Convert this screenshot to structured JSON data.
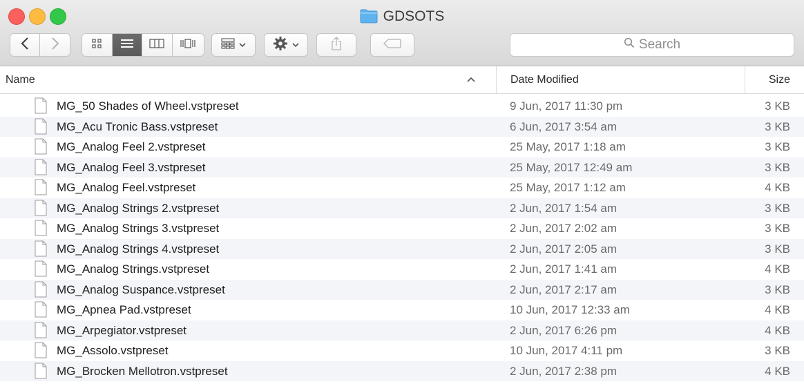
{
  "window": {
    "title": "GDSOTS"
  },
  "toolbar": {
    "back": "back",
    "forward": "forward",
    "view_modes": [
      "icon-view",
      "list-view",
      "column-view",
      "cover-flow-view"
    ],
    "active_view": "list-view",
    "arrange": "arrange",
    "action": "action",
    "share": "share",
    "tags": "tags"
  },
  "search": {
    "placeholder": "Search"
  },
  "columns": {
    "name": "Name",
    "date": "Date Modified",
    "size": "Size"
  },
  "files": [
    {
      "name": "MG_50 Shades of Wheel.vstpreset",
      "date": "9 Jun, 2017 11:30 pm",
      "size": "3 KB"
    },
    {
      "name": "MG_Acu Tronic Bass.vstpreset",
      "date": "6 Jun, 2017 3:54 am",
      "size": "3 KB"
    },
    {
      "name": "MG_Analog Feel 2.vstpreset",
      "date": "25 May, 2017 1:18 am",
      "size": "3 KB"
    },
    {
      "name": "MG_Analog Feel 3.vstpreset",
      "date": "25 May, 2017 12:49 am",
      "size": "3 KB"
    },
    {
      "name": "MG_Analog Feel.vstpreset",
      "date": "25 May, 2017 1:12 am",
      "size": "4 KB"
    },
    {
      "name": "MG_Analog Strings 2.vstpreset",
      "date": "2 Jun, 2017 1:54 am",
      "size": "3 KB"
    },
    {
      "name": "MG_Analog Strings 3.vstpreset",
      "date": "2 Jun, 2017 2:02 am",
      "size": "3 KB"
    },
    {
      "name": "MG_Analog Strings 4.vstpreset",
      "date": "2 Jun, 2017 2:05 am",
      "size": "3 KB"
    },
    {
      "name": "MG_Analog Strings.vstpreset",
      "date": "2 Jun, 2017 1:41 am",
      "size": "4 KB"
    },
    {
      "name": "MG_Analog Suspance.vstpreset",
      "date": "2 Jun, 2017 2:17 am",
      "size": "3 KB"
    },
    {
      "name": "MG_Apnea Pad.vstpreset",
      "date": "10 Jun, 2017 12:33 am",
      "size": "4 KB"
    },
    {
      "name": "MG_Arpegiator.vstpreset",
      "date": "2 Jun, 2017 6:26 pm",
      "size": "4 KB"
    },
    {
      "name": "MG_Assolo.vstpreset",
      "date": "10 Jun, 2017 4:11 pm",
      "size": "3 KB"
    },
    {
      "name": "MG_Brocken Mellotron.vstpreset",
      "date": "2 Jun, 2017 2:38 pm",
      "size": "4 KB"
    }
  ],
  "colors": {
    "close": "#fc605c",
    "minimize": "#fdbc40",
    "zoom": "#34c84a",
    "folder": "#5fb4f0",
    "row_stripe": "#f3f5f9"
  }
}
